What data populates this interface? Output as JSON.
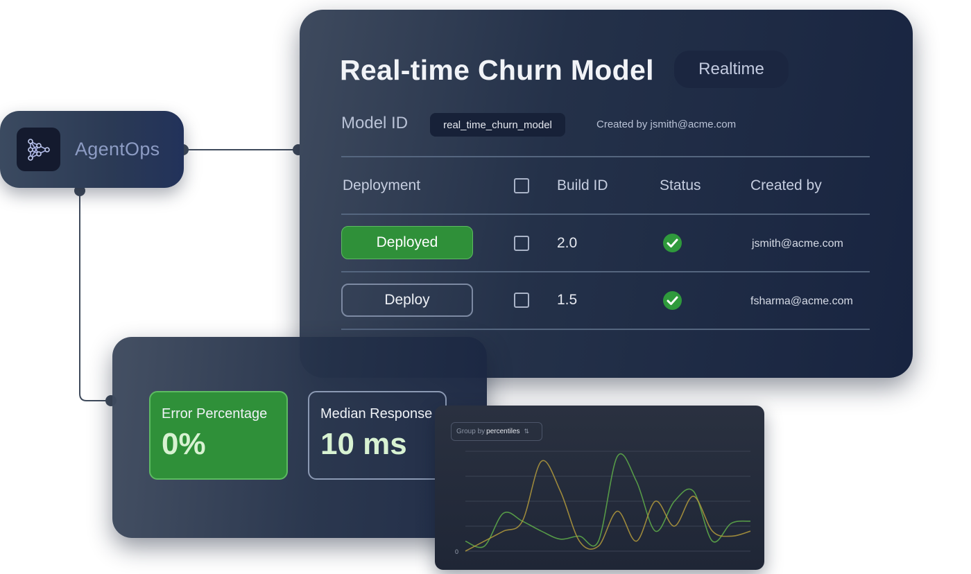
{
  "agent_node": {
    "label": "AgentOps",
    "icon": "network-graph-icon"
  },
  "model_card": {
    "title": "Real-time Churn Model",
    "badge": "Realtime",
    "model_id_label": "Model ID",
    "model_id": "real_time_churn_model",
    "created_by": "Created by jsmith@acme.com",
    "columns": {
      "deployment": "Deployment",
      "build_id": "Build ID",
      "status": "Status",
      "created_by": "Created by"
    },
    "rows": [
      {
        "action": "Deployed",
        "build_id": "2.0",
        "status": "check-circle-icon",
        "created_by": "jsmith@acme.com"
      },
      {
        "action": "Deploy",
        "build_id": "1.5",
        "status": "check-circle-icon",
        "created_by": "fsharma@acme.com"
      }
    ]
  },
  "metrics": {
    "error": {
      "label": "Error Percentage",
      "value": "0%"
    },
    "median": {
      "label": "Median Response",
      "value": "10 ms"
    }
  },
  "chart_card": {
    "group_by_label": "Group by",
    "group_by_value": "percentiles"
  },
  "colors": {
    "accent_green": "#2f9039",
    "card_dark": "#1b2640",
    "series_green": "#5fae4a",
    "series_yellow": "#b39a3c"
  },
  "chart_data": {
    "type": "line",
    "ytick_labels": [
      "0"
    ],
    "grid": true,
    "series": [
      {
        "values": [
          10,
          5,
          38,
          30,
          20,
          12,
          15,
          10,
          95,
          70,
          20,
          50,
          60,
          10,
          28,
          30
        ]
      },
      {
        "values": [
          0,
          10,
          20,
          30,
          90,
          60,
          10,
          5,
          40,
          10,
          50,
          25,
          55,
          20,
          15,
          20
        ]
      }
    ]
  }
}
